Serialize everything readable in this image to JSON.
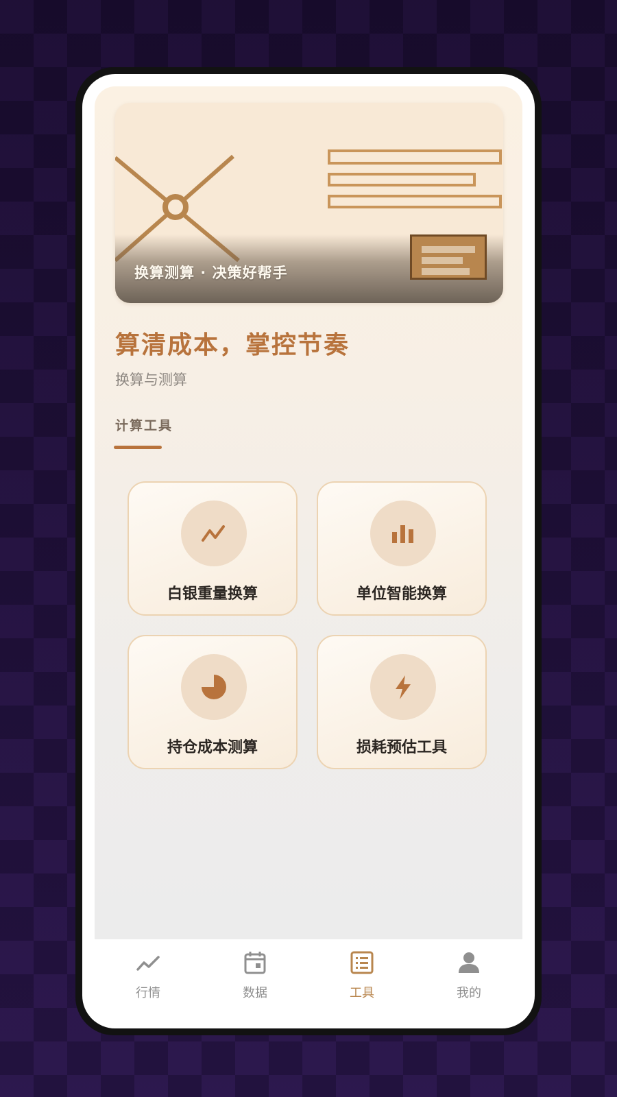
{
  "banner": {
    "caption": "换算测算 · 决策好帮手"
  },
  "hero": {
    "title": "算清成本，掌控节奏",
    "subtitle": "换算与测算"
  },
  "section": {
    "label": "计算工具"
  },
  "tools": [
    {
      "label": "白银重量换算",
      "icon": "trend-zigzag-icon"
    },
    {
      "label": "单位智能换算",
      "icon": "bar-chart-icon"
    },
    {
      "label": "持仓成本测算",
      "icon": "pie-chart-icon"
    },
    {
      "label": "损耗预估工具",
      "icon": "lightning-icon"
    }
  ],
  "bottom_nav": {
    "items": [
      {
        "label": "行情",
        "icon": "chart-line-icon",
        "active": false
      },
      {
        "label": "数据",
        "icon": "calendar-icon",
        "active": false
      },
      {
        "label": "工具",
        "icon": "list-document-icon",
        "active": true
      },
      {
        "label": "我的",
        "icon": "person-icon",
        "active": false
      }
    ]
  },
  "colors": {
    "accent": "#b8733c",
    "tile_icon_bg": "#efdcc7",
    "nav_active": "#b8864e",
    "nav_inactive": "#8f8f8f"
  }
}
